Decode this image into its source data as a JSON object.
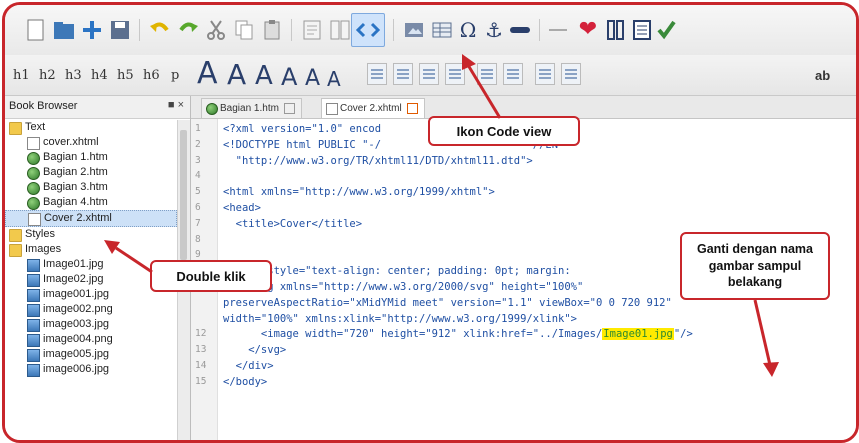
{
  "colors": {
    "accent": "#c8262b",
    "highlight": "#ffea00",
    "active_tool": "#cfe3fb"
  },
  "toolbar_icons": [
    "new-file-icon",
    "open-folder-icon",
    "add-file-icon",
    "save-icon",
    "undo-icon",
    "redo-icon",
    "cut-icon",
    "copy-icon",
    "paste-icon",
    "book-view-icon",
    "split-view-icon",
    "code-view-icon",
    "image-icon",
    "table-icon",
    "omega-icon",
    "anchor-icon",
    "link-icon",
    "hr-icon",
    "heart-icon",
    "metadata-icon",
    "toc-icon",
    "check-icon"
  ],
  "format_toolbar": {
    "headings": [
      "h1",
      "h2",
      "h3",
      "h4",
      "h5",
      "h6",
      "p"
    ],
    "font_size_glyph": "A",
    "right_label": "ab"
  },
  "book_browser": {
    "title": "Book Browser",
    "controls": "■ ×",
    "tree": [
      {
        "label": "Text",
        "type": "folder",
        "level": 0
      },
      {
        "label": "cover.xhtml",
        "type": "doc",
        "level": 1
      },
      {
        "label": "Bagian 1.htm",
        "type": "globe",
        "level": 1
      },
      {
        "label": "Bagian 2.htm",
        "type": "globe",
        "level": 1
      },
      {
        "label": "Bagian 3.htm",
        "type": "globe",
        "level": 1
      },
      {
        "label": "Bagian 4.htm",
        "type": "globe",
        "level": 1
      },
      {
        "label": "Cover 2.xhtml",
        "type": "doc",
        "level": 1,
        "selected": true
      },
      {
        "label": "Styles",
        "type": "folder",
        "level": 0
      },
      {
        "label": "Images",
        "type": "folder",
        "level": 0
      },
      {
        "label": "Image01.jpg",
        "type": "img",
        "level": 1
      },
      {
        "label": "Image02.jpg",
        "type": "img",
        "level": 1
      },
      {
        "label": "image001.jpg",
        "type": "img",
        "level": 1
      },
      {
        "label": "image002.png",
        "type": "img",
        "level": 1
      },
      {
        "label": "image003.jpg",
        "type": "img",
        "level": 1
      },
      {
        "label": "image004.png",
        "type": "img",
        "level": 1
      },
      {
        "label": "image005.jpg",
        "type": "img",
        "level": 1
      },
      {
        "label": "image006.jpg",
        "type": "img",
        "level": 1
      }
    ]
  },
  "tabs": [
    {
      "label": "Bagian 1.htm",
      "active": false
    },
    {
      "label": "Cover 2.xhtml",
      "active": true
    }
  ],
  "code": {
    "line_numbers": [
      "1",
      "2",
      "3",
      "4",
      "5",
      "6",
      "7",
      "8",
      "9",
      "10",
      "11",
      "",
      "",
      "12",
      "13",
      "14",
      "15"
    ],
    "lines": [
      "<?xml version=\"1.0\" encod",
      "<!DOCTYPE html PUBLIC \"-/                        //EN\"",
      "  \"http://www.w3.org/TR/xhtml11/DTD/xhtml11.dtd\">",
      "",
      "<html xmlns=\"http://www.w3.org/1999/xhtml\">",
      "<head>",
      "  <title>Cover</title>",
      "",
      "",
      "  <div style=\"text-align: center; padding: 0pt; margin:",
      "    <svg xmlns=\"http://www.w3.org/2000/svg\" height=\"100%\"",
      "preserveAspectRatio=\"xMidYMid meet\" version=\"1.1\" viewBox=\"0 0 720 912\"",
      "width=\"100%\" xmlns:xlink=\"http://www.w3.org/1999/xlink\">",
      "      <image width=\"720\" height=\"912\" xlink:href=\"../Images/",
      "    </svg>",
      "  </div>",
      "</body>"
    ],
    "highlighted_filename": "Image01.jpg",
    "after_highlight": "\"/>"
  },
  "callouts": {
    "code_view": "Ikon Code view",
    "double_click": "Double klik",
    "replace_image": "Ganti dengan nama gambar sampul belakang"
  }
}
